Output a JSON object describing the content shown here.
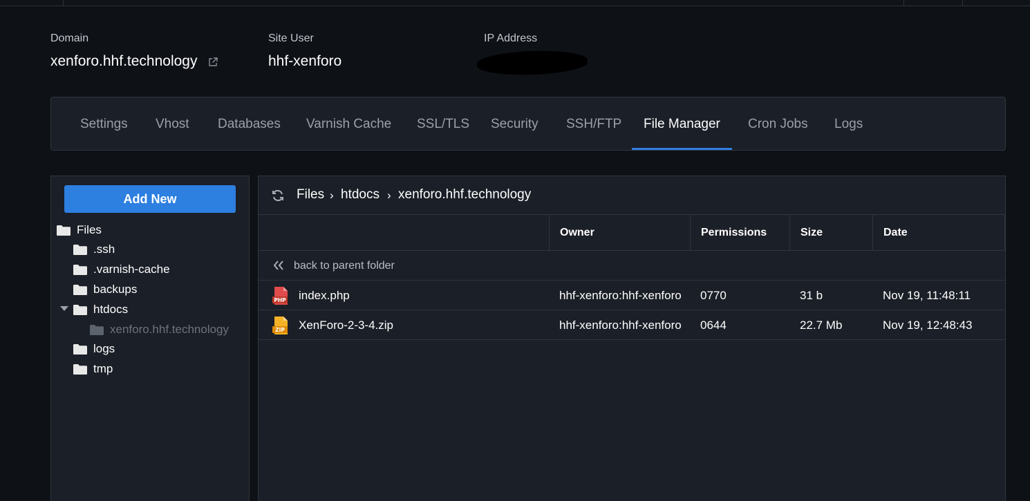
{
  "info": {
    "domain_label": "Domain",
    "domain_value": "xenforo.hhf.technology",
    "site_user_label": "Site User",
    "site_user_value": "hhf-xenforo",
    "ip_label": "IP Address"
  },
  "tabs": [
    {
      "label": "Settings"
    },
    {
      "label": "Vhost"
    },
    {
      "label": "Databases"
    },
    {
      "label": "Varnish Cache"
    },
    {
      "label": "SSL/TLS"
    },
    {
      "label": "Security"
    },
    {
      "label": "SSH/FTP"
    },
    {
      "label": "File Manager",
      "active": true
    },
    {
      "label": "Cron Jobs"
    },
    {
      "label": "Logs"
    }
  ],
  "sidebar": {
    "add_new": "Add New",
    "tree": [
      {
        "label": "Files"
      },
      {
        "label": ".ssh"
      },
      {
        "label": ".varnish-cache"
      },
      {
        "label": "backups"
      },
      {
        "label": "htdocs"
      },
      {
        "label": "xenforo.hhf.technology"
      },
      {
        "label": "logs"
      },
      {
        "label": "tmp"
      }
    ]
  },
  "breadcrumb": [
    "Files",
    "htdocs",
    "xenforo.hhf.technology"
  ],
  "table": {
    "headers": [
      "Owner",
      "Permissions",
      "Size",
      "Date"
    ],
    "back_label": "back to parent folder",
    "rows": [
      {
        "name": "index.php",
        "icon": "php-file-icon",
        "owner": "hhf-xenforo:hhf-xenforo",
        "permissions": "0770",
        "size": "31 b",
        "date": "Nov 19, 11:48:11"
      },
      {
        "name": "XenForo-2-3-4.zip",
        "icon": "zip-file-icon",
        "owner": "hhf-xenforo:hhf-xenforo",
        "permissions": "0644",
        "size": "22.7 Mb",
        "date": "Nov 19, 12:48:43"
      }
    ]
  },
  "colors": {
    "accent": "#2d7fe0",
    "background": "#0e1116",
    "panel": "#1b1f27"
  }
}
